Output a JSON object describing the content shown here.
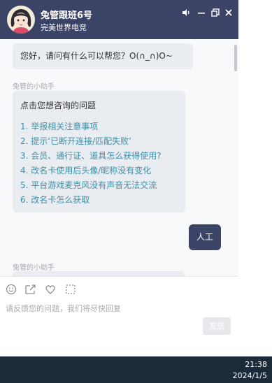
{
  "header": {
    "title": "兔管跟班6号",
    "subtitle": "完美世界电竞",
    "controls": [
      "volume-icon",
      "minimize-icon",
      "restore-icon",
      "close-icon"
    ]
  },
  "chat": {
    "greeting": "您好，请问有什么可以帮您？O(∩_∩)O~",
    "assistant_name": "兔管的小助手",
    "faq_heading": "点击您想咨询的问题",
    "faq_items": [
      "1. 举报相关注意事项",
      "2. 提示‘已断开连接/匹配失败’",
      "3. 会员、通行证、道具怎么获得使用?",
      "4. 改名卡使用后头像/昵称没有变化",
      "5. 平台游戏麦克风没有声音无法交流",
      "6. 改名卡怎么获取"
    ],
    "user_message": "人工",
    "assistant_name_2": "兔管的小助手"
  },
  "composer": {
    "tools": [
      "emoji-icon",
      "screenshot-icon",
      "heart-icon",
      "crop-icon"
    ],
    "placeholder": "请反馈您的问题，我们将尽快回复",
    "send_label": "发送"
  },
  "taskbar": {
    "time": "21:38",
    "date": "2024/1/5"
  },
  "colors": {
    "header": "#3b4466",
    "link": "#3d8fa8",
    "bubble": "#e9ecf0",
    "taskbar": "#1c2a3a"
  }
}
